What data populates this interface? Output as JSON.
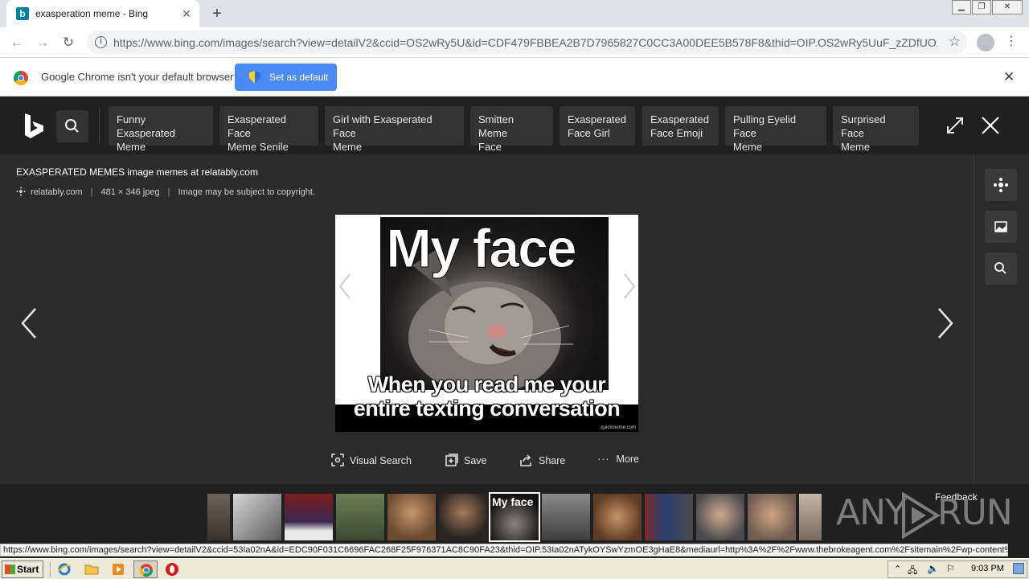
{
  "browser": {
    "tab_title": "exasperation meme - Bing",
    "tab_favicon_letter": "b",
    "url": "https://www.bing.com/images/search?view=detailV2&ccid=OS2wRy5U&id=CDF479FBBEA2B7D7965827C0CC3A00DEE5B578F8&thid=OIP.OS2wRy5UuF_zZDfUOzL...",
    "infobar_message": "Google Chrome isn't your default browser",
    "set_default_label": "Set as default"
  },
  "bing": {
    "related_searches": [
      {
        "line1": "Funny Exasperated",
        "line2": "Meme"
      },
      {
        "line1": "Exasperated Face",
        "line2": "Meme Senile"
      },
      {
        "line1": "Girl with Exasperated Face",
        "line2": "Meme"
      },
      {
        "line1": "Smitten Meme",
        "line2": "Face"
      },
      {
        "line1": "Exasperated",
        "line2": "Face Girl"
      },
      {
        "line1": "Exasperated",
        "line2": "Face Emoji"
      },
      {
        "line1": "Pulling Eyelid Face",
        "line2": "Meme"
      },
      {
        "line1": "Surprised Face",
        "line2": "Meme"
      }
    ]
  },
  "image": {
    "title": "EXASPERATED MEMES image memes at relatably.com",
    "source": "relatably.com",
    "dimensions": "481 × 346 jpeg",
    "copyright": "Image may be subject to copyright.",
    "meme_top_text": "My face",
    "meme_bottom_text_line1": "When you read me your",
    "meme_bottom_text_line2": "entire texting conversation",
    "watermark": "quickmeme.com"
  },
  "actions": {
    "visual_search": "Visual Search",
    "save": "Save",
    "share": "Share",
    "more": "More"
  },
  "filmstrip": {
    "selected_thumb_text": "My face",
    "feedback": "Feedback",
    "watermark_any": "ANY",
    "watermark_run": "RUN"
  },
  "status_url": "https://www.bing.com/images/search?view=detailV2&ccid=53Ia02nA&id=EDC90F031C6696FAC268F25F976371AC8C90FA23&thid=OIP.53Ia02nATykOYSwYzmOE3gHaE8&mediaurl=http%3A%2F%2Fwww.thebrokeagent.com%2Fsitemain%2Fwp-content%...",
  "taskbar": {
    "start_label": "Start",
    "clock": "9:03 PM"
  },
  "colors": {
    "bing_bg": "#202020",
    "viewer_bg": "#2b2b2b",
    "chip_bg": "#333333",
    "set_default_blue": "#4a8af4"
  }
}
